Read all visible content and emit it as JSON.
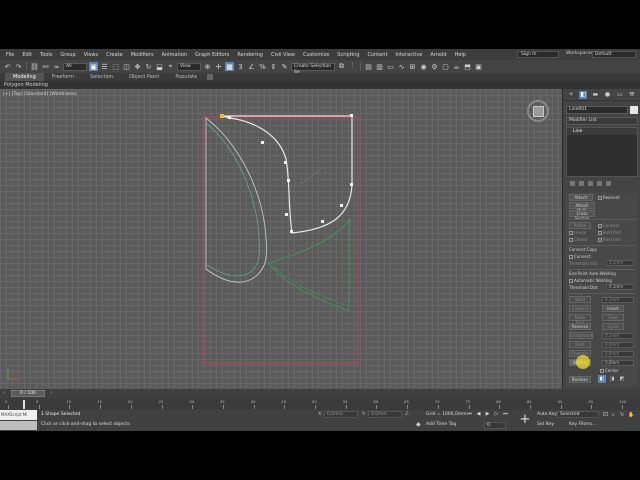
{
  "menu": {
    "items": [
      "File",
      "Edit",
      "Tools",
      "Group",
      "Views",
      "Create",
      "Modifiers",
      "Animation",
      "Graph Editors",
      "Rendering",
      "Civil View",
      "Customize",
      "Scripting",
      "Content",
      "Interactive",
      "Arnold",
      "Help"
    ],
    "signin": "Sign In",
    "workspace_label": "Workspaces:",
    "workspace_value": "Default"
  },
  "toolbar": {
    "filter_dropdown": "All",
    "coord_dropdown": "View",
    "selection_set": "Create Selection Se"
  },
  "ribbon": {
    "tabs": [
      "Modeling",
      "Freeform",
      "Selection",
      "Object Paint",
      "Populate"
    ],
    "active_tab": "Modeling",
    "subtitle": "Polygon Modeling"
  },
  "viewport": {
    "label": "[+] [Top] [Standard] [Wireframe]"
  },
  "command_panel": {
    "object_name": "Line001",
    "modifier_list": "Modifier List",
    "stack_item": "Line",
    "attach": "Attach",
    "reorient": "Reorient",
    "attach_mult": "Attach Mult.",
    "cross_section": "Cross Section",
    "refine": "Refine",
    "connect_check": "Connect",
    "linear": "Linear",
    "bind_first": "Bind first",
    "closed": "Closed",
    "bind_last": "Bind last",
    "connect_copy": "Connect Copy",
    "connect2": "Connect",
    "threshold1": "Threshold dist",
    "threshold1_val": "0,1mm",
    "end_point_weld": "End Point Auto-Welding",
    "auto_weld": "Automatic Welding",
    "threshold2": "Threshold Dist",
    "threshold2_val": "0,1mm",
    "weld": "Weld",
    "weld_val": "0,1mm",
    "connect_btn": "Connect",
    "insert_btn": "Insert",
    "make_first": "Make First",
    "fuse": "Fuse",
    "reverse": "Reverse",
    "cycle": "Cycle",
    "crossinsert": "CrossInsert",
    "crossinsert_val": "0,1mm",
    "fillet": "Fillet",
    "fillet_val": "0,0mm",
    "chamfer": "Chamfer",
    "chamfer_val": "0,0mm",
    "outline": "Outline",
    "outline_val": "0,0mm",
    "mirror_label": "Mirror",
    "center": "Center",
    "boolean": "Boolean"
  },
  "timeline": {
    "slider": "0 / 100",
    "ticks": [
      0,
      5,
      10,
      15,
      20,
      25,
      30,
      35,
      40,
      45,
      50,
      55,
      60,
      65,
      70,
      75,
      80,
      85,
      90,
      95,
      100
    ]
  },
  "status": {
    "maxscript": "MAXScript Mi",
    "selection": "1 Shape Selected",
    "prompt": "Click or click-and-drag to select objects",
    "x_label": "X:",
    "x_value": "0,0mm",
    "y_label": "Y:",
    "y_value": "0,0mm",
    "z_label": "Z:",
    "grid": "Grid = 1000,0mm",
    "time_tag": "Add Time Tag",
    "frame": "0",
    "auto_key": "Auto Key",
    "set_key": "Set Key",
    "selected": "Selected",
    "key_filters": "Key Filters..."
  },
  "colors": {
    "selected_spline": "#e8e8e8",
    "vertex_handle": "#f2f2f2",
    "first_vertex": "#f0c020",
    "active_tool": "#5a83b5",
    "rect_outline": "#d04050",
    "green_shape": "#3aa64a"
  }
}
